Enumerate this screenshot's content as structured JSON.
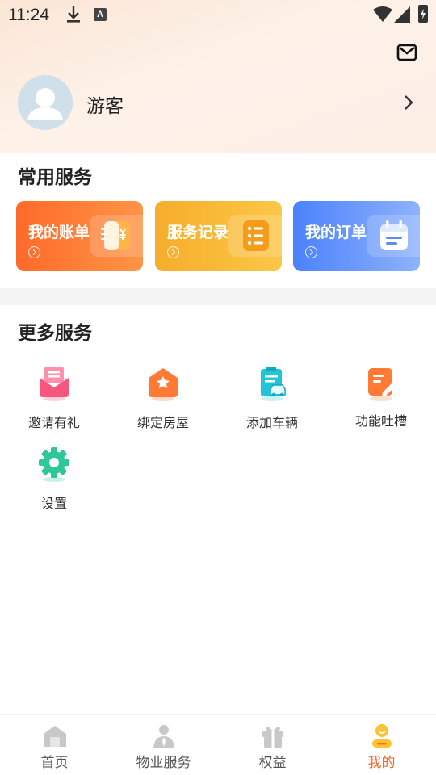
{
  "status_bar": {
    "time": "11:24"
  },
  "profile": {
    "username": "游客"
  },
  "common_services": {
    "title": "常用服务",
    "cards": [
      {
        "label": "我的账单",
        "icon": "bill-icon",
        "gradient_from": "#ff6a2a",
        "gradient_to": "#ff9446"
      },
      {
        "label": "服务记录",
        "icon": "service-record-icon",
        "gradient_from": "#f6ad2b",
        "gradient_to": "#fcc747"
      },
      {
        "label": "我的订单",
        "icon": "order-calendar-icon",
        "gradient_from": "#4b82fb",
        "gradient_to": "#8eb2fd"
      }
    ]
  },
  "more_services": {
    "title": "更多服务",
    "items": [
      {
        "label": "邀请有礼",
        "icon": "invite-gift-icon"
      },
      {
        "label": "绑定房屋",
        "icon": "bind-house-icon"
      },
      {
        "label": "添加车辆",
        "icon": "add-vehicle-icon"
      },
      {
        "label": "功能吐槽",
        "icon": "feedback-icon"
      },
      {
        "label": "设置",
        "icon": "settings-icon"
      }
    ]
  },
  "bottom_nav": {
    "items": [
      {
        "label": "首页",
        "icon": "home-icon"
      },
      {
        "label": "物业服务",
        "icon": "property-service-icon"
      },
      {
        "label": "权益",
        "icon": "gift-benefits-icon"
      },
      {
        "label": "我的",
        "icon": "profile-icon",
        "active": true
      }
    ],
    "active_color": "#f26d2d"
  }
}
